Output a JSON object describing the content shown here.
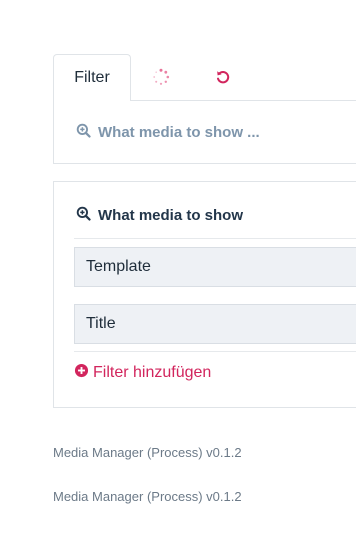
{
  "tabs": {
    "filter_label": "Filter",
    "spinner_icon": "loading-spinner-icon",
    "reset_icon": "reset-icon"
  },
  "collapsed_panel": {
    "label": "What media to show ...",
    "icon": "zoom-in-icon"
  },
  "filter_panel": {
    "heading": "What media to show",
    "heading_icon": "zoom-in-icon",
    "fields": [
      {
        "label": "Template"
      },
      {
        "label": "Title"
      }
    ],
    "add_filter_label": "Filter hinzufügen",
    "add_filter_icon": "plus-circle-icon"
  },
  "footer": {
    "lines": [
      "Media Manager (Process) v0.1.2",
      "Media Manager (Process) v0.1.2"
    ]
  },
  "colors": {
    "accent": "#d2255d",
    "muted_link": "#7e95ab",
    "heading": "#23364a",
    "field_bg": "#eef1f5",
    "border": "#e0e4e8"
  }
}
